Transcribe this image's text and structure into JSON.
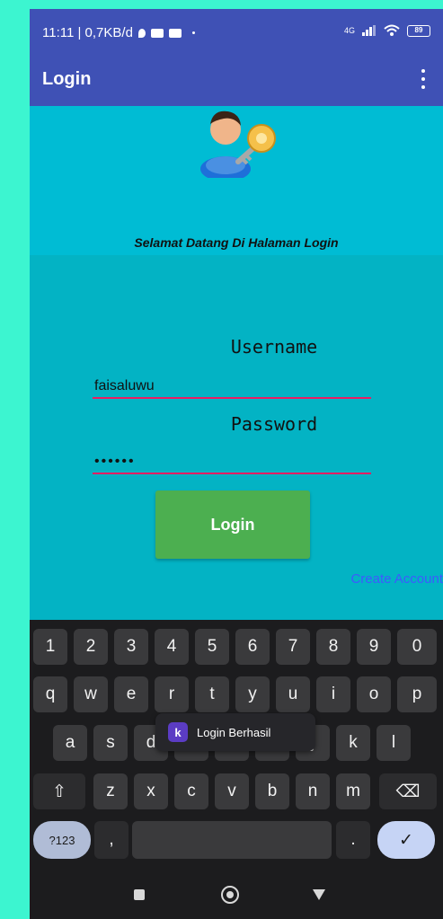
{
  "status_bar": {
    "time_info": "11:11 | 0,7KB/d",
    "network": "4G",
    "battery": "89"
  },
  "app_bar": {
    "title": "Login",
    "menu_icon": "more-vert-icon"
  },
  "header": {
    "avatar_icon": "user-key-icon",
    "welcome": "Selamat Datang Di Halaman Login"
  },
  "form": {
    "username_label": "Username",
    "username_value": "faisaluwu",
    "password_label": "Password",
    "password_value": "••••••",
    "login_button": "Login",
    "create_account": "Create Account"
  },
  "toast": {
    "icon_letter": "k",
    "message": "Login Berhasil"
  },
  "keyboard": {
    "row_numbers": [
      "1",
      "2",
      "3",
      "4",
      "5",
      "6",
      "7",
      "8",
      "9",
      "0"
    ],
    "row_1": [
      "q",
      "w",
      "e",
      "r",
      "t",
      "y",
      "u",
      "i",
      "o",
      "p"
    ],
    "row_2": [
      "a",
      "s",
      "d",
      "f",
      "g",
      "h",
      "j",
      "k",
      "l"
    ],
    "row_3": [
      "z",
      "x",
      "c",
      "v",
      "b",
      "n",
      "m"
    ],
    "shift": "⇧",
    "backspace": "⌫",
    "symbols": "?123",
    "comma": ",",
    "period": ".",
    "enter": "✓"
  },
  "colors": {
    "app_bar": "#3f51b5",
    "header_bg": "#00bcd4",
    "form_bg": "#03b3c4",
    "button": "#4caf50",
    "underline": "#e91e63",
    "link": "#3d5afe"
  }
}
